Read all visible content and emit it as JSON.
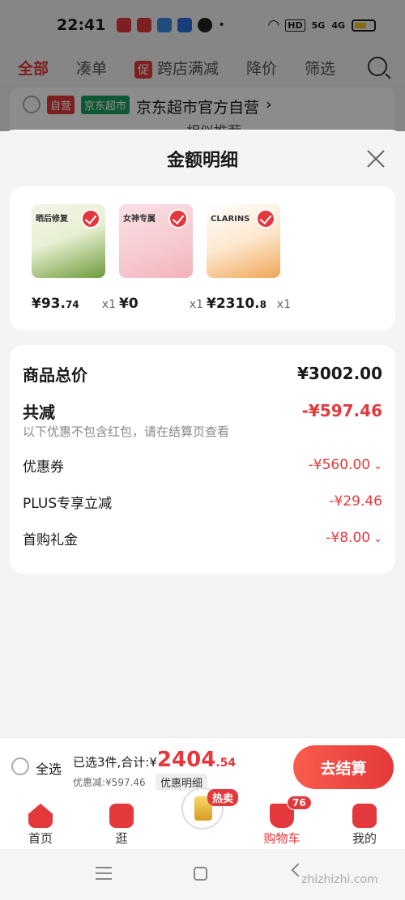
{
  "status_bar": {
    "time": "22:41",
    "network": "5G",
    "network2": "4G",
    "hd": "HD"
  },
  "background_page": {
    "tabs": [
      "全部",
      "凑单",
      "跨店满减",
      "降价",
      "筛选"
    ],
    "promo_badge": "促",
    "store": {
      "tag_self": "自营",
      "tag_jd": "京东超市",
      "name": "京东超市官方自营",
      "arrow": "›",
      "similar": "相似推荐"
    }
  },
  "sheet": {
    "title": "金额明细",
    "products": [
      {
        "price_int": "¥93.",
        "price_dec": "74",
        "qty": "x1",
        "thumb_note": "晒后修复"
      },
      {
        "price_int": "¥0",
        "price_dec": "",
        "qty": "x1",
        "thumb_note": "女神专属"
      },
      {
        "price_int": "¥2310.",
        "price_dec": "8",
        "qty": "x1",
        "thumb_note": "CLARINS"
      }
    ],
    "details": {
      "total_label": "商品总价",
      "total_value": "¥3002.00",
      "save_label": "共减",
      "save_value": "-¥597.46",
      "save_note": "以下优惠不包含红包，请在结算页查看",
      "coupon_label": "优惠券",
      "coupon_value": "-¥560.00",
      "plus_label": "PLUS专享立减",
      "plus_value": "-¥29.46",
      "gift_label": "首购礼金",
      "gift_value": "-¥8.00"
    }
  },
  "checkout": {
    "select_all": "全选",
    "summary_prefix": "已选3件,合计:¥",
    "amount_int": "2404",
    "amount_dec": ".54",
    "saved": "优惠减:¥597.46",
    "detail_btn": "优惠明细",
    "checkout_btn": "去结算"
  },
  "nav": {
    "items": [
      "首页",
      "逛",
      "购物车",
      "我的"
    ],
    "hot_badge": "热卖",
    "cart_count": "76"
  },
  "watermark": "zhizhizhi.com",
  "colors": {
    "accent": "#e4393c",
    "jd_green": "#19a15f"
  }
}
